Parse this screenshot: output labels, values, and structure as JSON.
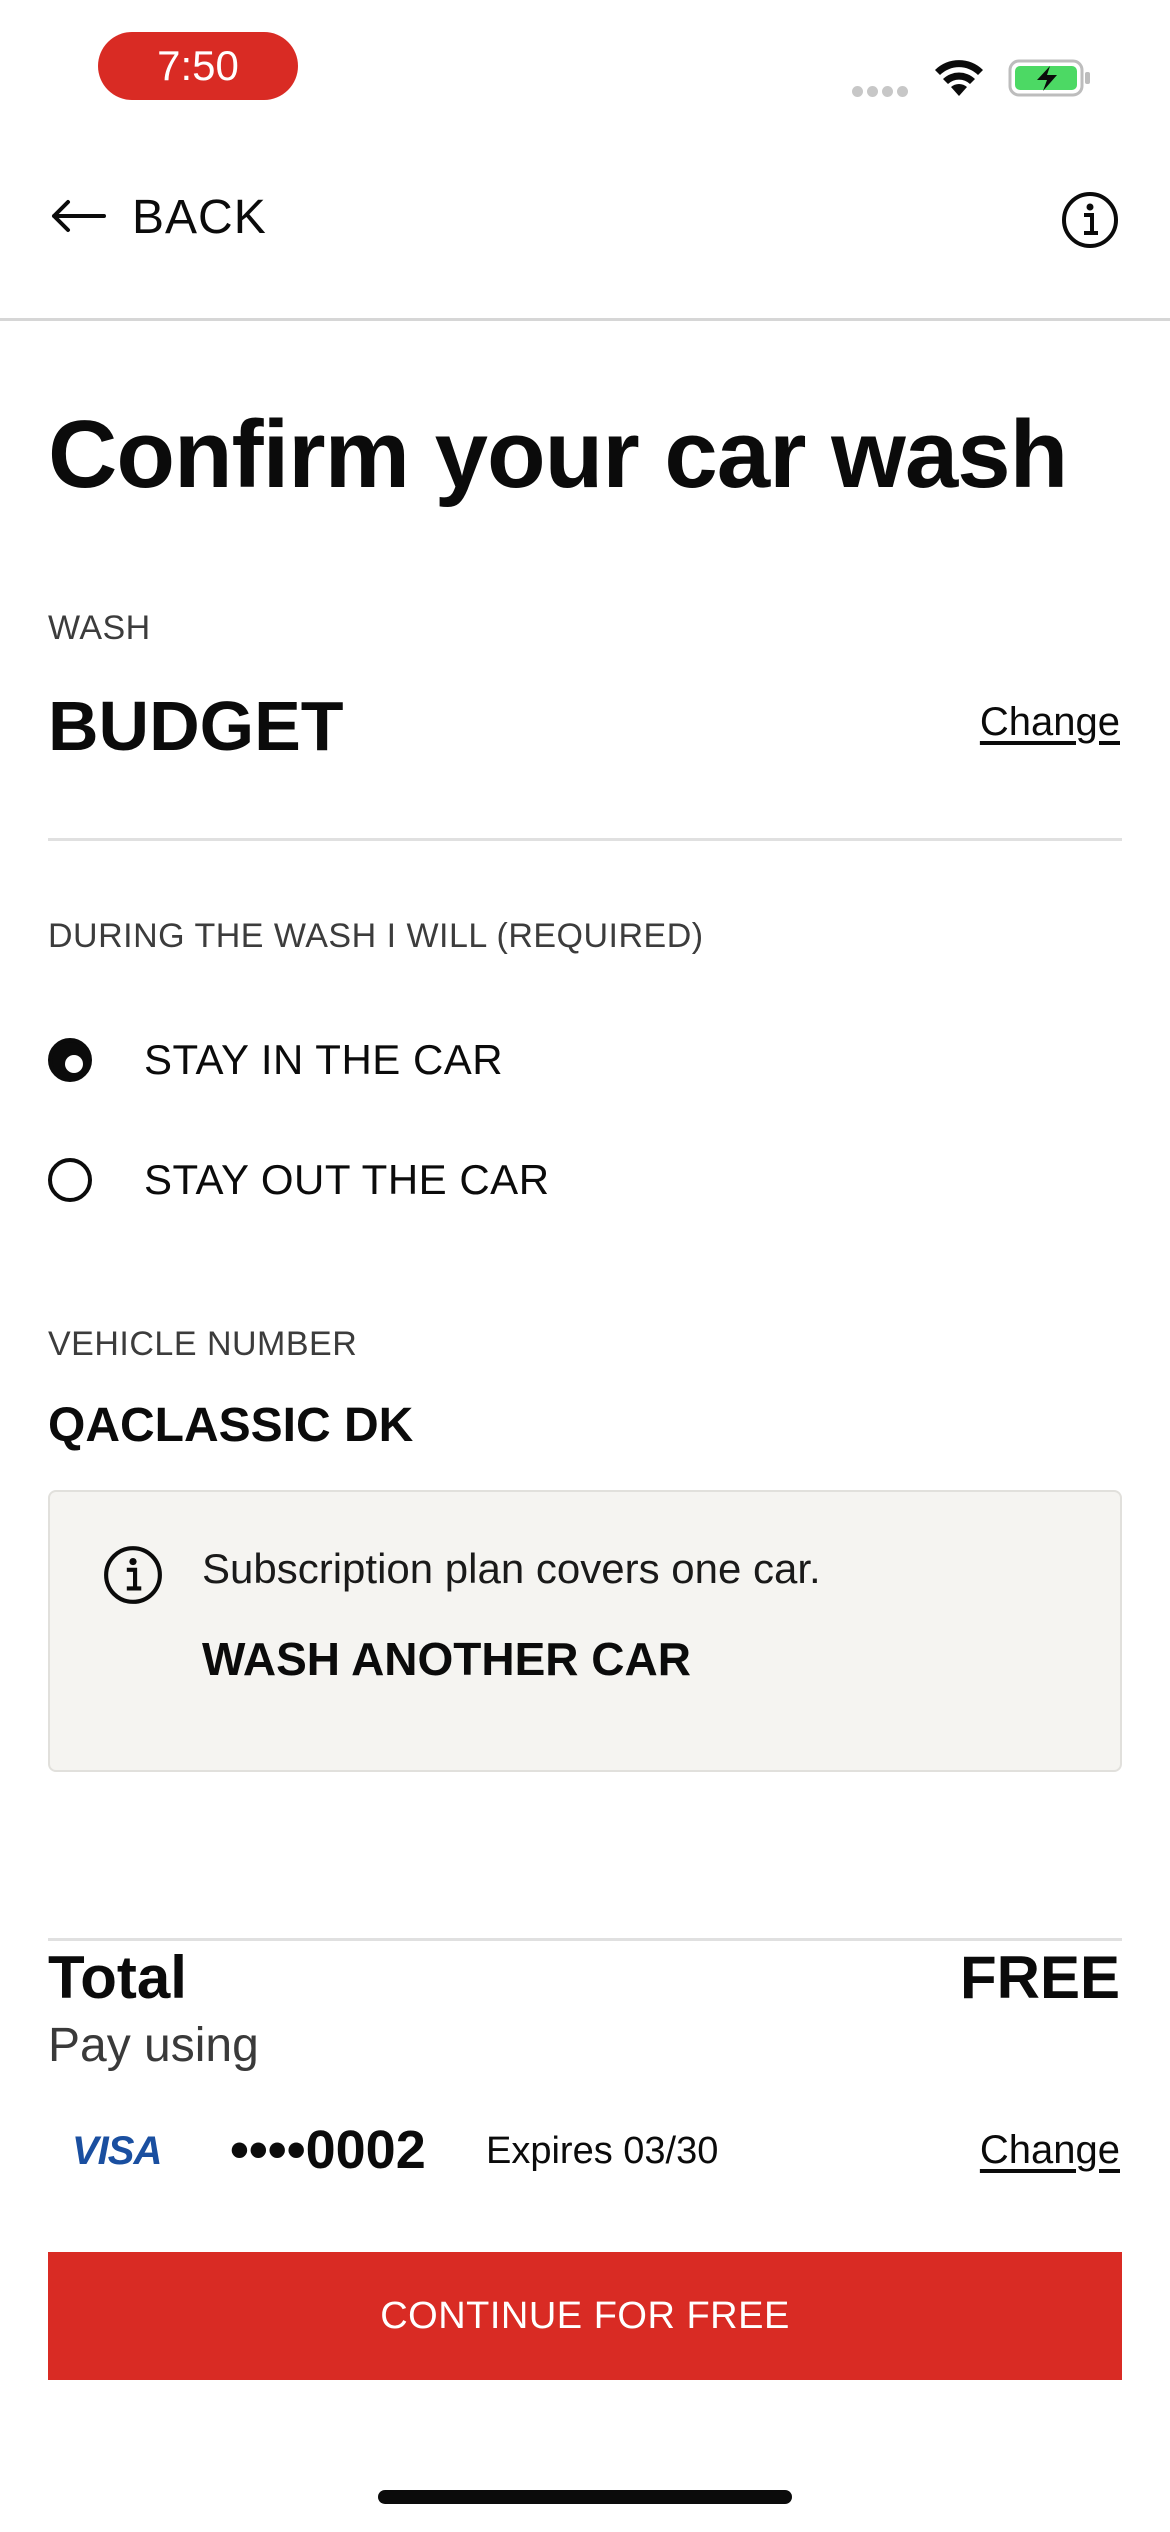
{
  "status_bar": {
    "time": "7:50"
  },
  "nav": {
    "back_label": "BACK",
    "back_icon": "arrow-left-icon",
    "info_icon": "info-icon"
  },
  "page": {
    "title": "Confirm your car wash"
  },
  "wash": {
    "label": "WASH",
    "name": "BUDGET",
    "change_label": "Change"
  },
  "during_wash": {
    "label": "DURING THE WASH I WILL (REQUIRED)",
    "options": [
      {
        "label": "STAY IN THE CAR",
        "selected": true
      },
      {
        "label": "STAY OUT THE CAR",
        "selected": false
      }
    ]
  },
  "vehicle": {
    "label": "VEHICLE NUMBER",
    "number": "QACLASSIC DK"
  },
  "notice": {
    "icon": "info-icon",
    "text": "Subscription plan covers one car.",
    "link_label": "WASH ANOTHER CAR"
  },
  "summary": {
    "total_label": "Total",
    "total_value": "FREE",
    "pay_using_label": "Pay using"
  },
  "payment": {
    "brand": "VISA",
    "card_number": "••••0002",
    "expiry": "Expires 03/30",
    "change_label": "Change"
  },
  "cta": {
    "label": "CONTINUE FOR FREE"
  },
  "colors": {
    "accent": "#d92b24",
    "text": "#0b0b0b",
    "notice_bg": "#f5f4f1",
    "battery": "#4cd964",
    "visa_blue": "#1a4fa0"
  }
}
